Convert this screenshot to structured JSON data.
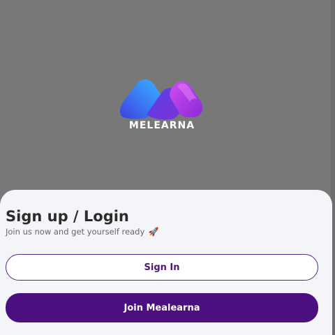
{
  "brand": {
    "name": "MELEARNA",
    "logo_icon": "m-gradient-logo-icon",
    "colors": {
      "blue": "#3aa4ff",
      "indigo": "#5b3df0",
      "purple": "#b43be8"
    }
  },
  "auth": {
    "title": "Sign up / Login",
    "subtitle": "Join us now and get yourself ready",
    "subtitle_icon": "rocket-icon",
    "signin_label": "Sign In",
    "join_label": "Join Mealearna"
  },
  "colors": {
    "background": "#787878",
    "sheet": "#f4f5f8",
    "primary": "#4c0f80"
  }
}
